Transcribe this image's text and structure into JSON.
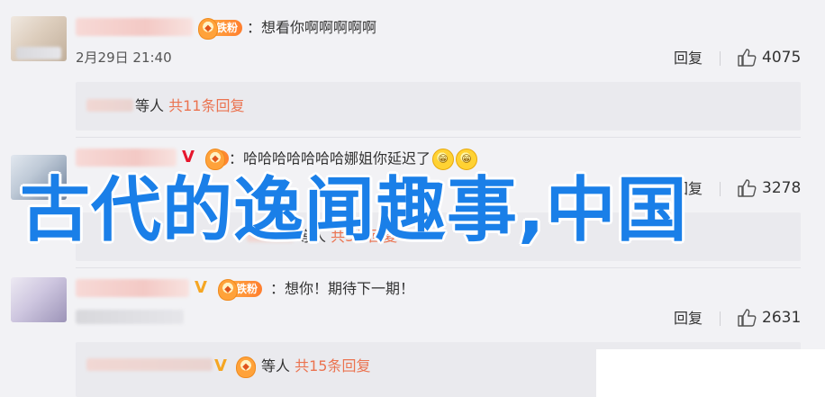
{
  "comments": [
    {
      "text": "：想看你啊啊啊啊啊",
      "fan_label": "铁粉",
      "fan_icon": "◆",
      "timestamp": "2月29日 21:40",
      "reply_label": "回复",
      "like_count": "4075",
      "replies_who": "等人",
      "replies_count": "共11条回复"
    },
    {
      "text": "：哈哈哈哈哈哈哈娜姐你延迟了",
      "vip_mark": "V",
      "fan_icon": "◆",
      "emoji": [
        "😁",
        "😁"
      ],
      "reply_label": "回复",
      "like_count": "3278",
      "replies_who": "等人",
      "replies_count": "共3条回复"
    },
    {
      "text": "：想你！期待下一期！",
      "vip_mark": "V",
      "fan_label": "铁粉",
      "fan_icon": "◆",
      "reply_label": "回复",
      "like_count": "2631",
      "replies_vip": "V",
      "replies_who": "等人",
      "replies_count": "共15条回复"
    }
  ],
  "overlay_title": "古代的逸闻趣事,中国",
  "colors": {
    "overlay_blue": "#1a7fe8",
    "link_orange": "#eb7350",
    "vip_red": "#e6162d",
    "vip_orange": "#f5a623",
    "background": "#f2f2f5"
  },
  "icons": {
    "like": "thumbs-up-icon",
    "fan_badge": "fan-badge-icon",
    "emoji": "grin-emoji-icon"
  }
}
